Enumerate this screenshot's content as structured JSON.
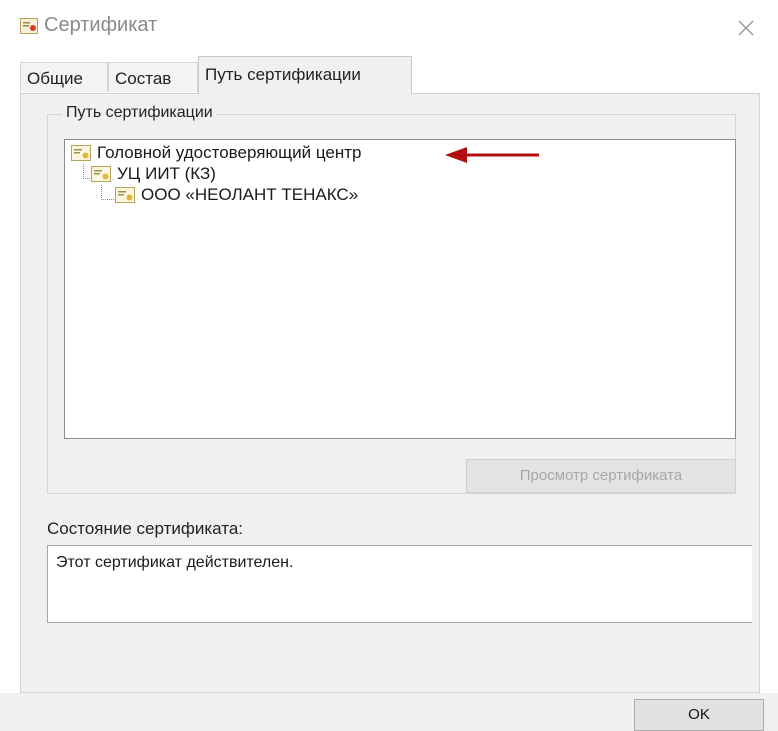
{
  "window": {
    "title": "Сертификат",
    "close_glyph": "✕"
  },
  "tabs": [
    {
      "label": "Общие"
    },
    {
      "label": "Состав"
    },
    {
      "label": "Путь сертификации"
    }
  ],
  "cert_path": {
    "group_label": "Путь сертификации",
    "items": [
      {
        "label": "Головной удостоверяющий центр",
        "icon": "certificate-icon"
      },
      {
        "label": "УЦ ИИТ (КЗ)",
        "icon": "certificate-icon"
      },
      {
        "label": "ООО «НЕОЛАНТ ТЕНАКС»",
        "icon": "certificate-icon"
      }
    ],
    "view_button": "Просмотр сертификата",
    "annotation_arrow_color": "#b01010"
  },
  "status": {
    "label": "Состояние сертификата:",
    "value": "Этот сертификат действителен."
  },
  "footer": {
    "ok_label": "OK"
  },
  "colors": {
    "accent": "#b01010",
    "panel": "#f0f0f0"
  }
}
